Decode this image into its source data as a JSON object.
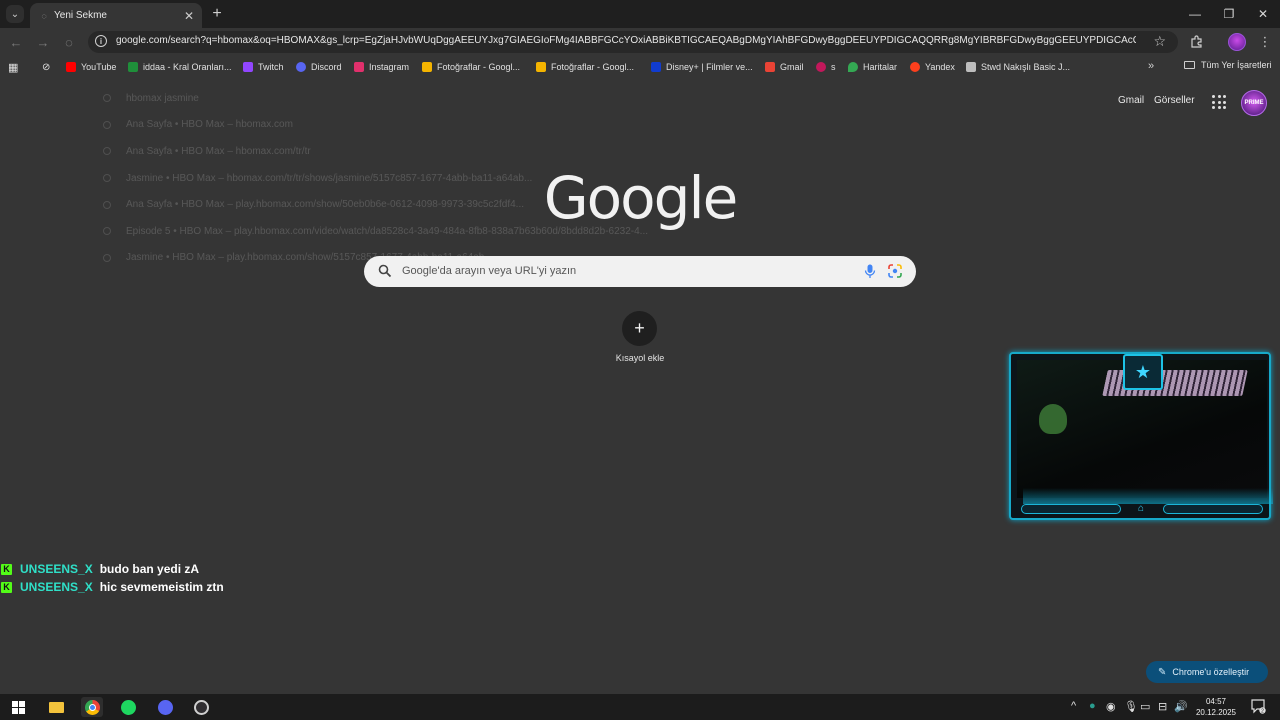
{
  "tab": {
    "title": "Yeni Sekme"
  },
  "toolbar": {
    "url": "google.com/search?q=hbomax&oq=HBOMAX&gs_lcrp=EgZjaHJvbWUqDggAEEUYJxg7GIAEGIoFMg4IABBFGCcYOxiABBiKBTIGCAEQABgDMgYIAhBFGDwyBggDEEUYPDIGCAQQRRg8MgYIBRBFGDwyBggGEEUYPDIGCAcQRRg..."
  },
  "bookmarks": {
    "items": [
      {
        "label": "YouTube",
        "icon": "youtube-icon",
        "color": "#ff0000"
      },
      {
        "label": "iddaa - Kral Oranları...",
        "icon": "iddaa-icon",
        "color": "#1f8f3a"
      },
      {
        "label": "Twitch",
        "icon": "twitch-icon",
        "color": "#9146ff"
      },
      {
        "label": "Discord",
        "icon": "discord-icon",
        "color": "#5865f2"
      },
      {
        "label": "Instagram",
        "icon": "instagram-icon",
        "color": "#e1306c"
      },
      {
        "label": "Fotoğraflar - Googl...",
        "icon": "google-photos-icon",
        "color": "#f4b400"
      },
      {
        "label": "Fotoğraflar - Googl...",
        "icon": "google-photos-icon",
        "color": "#f4b400"
      },
      {
        "label": "Disney+ | Filmler ve...",
        "icon": "disney-icon",
        "color": "#113ccf"
      },
      {
        "label": "Gmail",
        "icon": "gmail-icon",
        "color": "#ea4335"
      },
      {
        "label": "s",
        "icon": "site-icon",
        "color": "#c2185b"
      },
      {
        "label": "Haritalar",
        "icon": "maps-icon",
        "color": "#34a853"
      },
      {
        "label": "Yandex",
        "icon": "yandex-icon",
        "color": "#fc3f1d"
      },
      {
        "label": "Stwd Nakışlı Basic J...",
        "icon": "store-icon",
        "color": "#bdbdbd"
      }
    ],
    "more": "»",
    "all_bookmarks": "Tüm Yer İşaretleri"
  },
  "suggestions": [
    {
      "title": "hbomax jasmine",
      "url": ""
    },
    {
      "title": "Ana Sayfa • HBO Max",
      "url": "hbomax.com"
    },
    {
      "title": "Ana Sayfa • HBO Max",
      "url": "hbomax.com/tr/tr"
    },
    {
      "title": "Jasmine • HBO Max",
      "url": "hbomax.com/tr/tr/shows/jasmine/5157c857-1677-4abb-ba11-a64ab..."
    },
    {
      "title": "Ana Sayfa • HBO Max",
      "url": "play.hbomax.com/show/50eb0b6e-0612-4098-9973-39c5c2fdf4..."
    },
    {
      "title": "Episode 5 • HBO Max",
      "url": "play.hbomax.com/video/watch/da8528c4-3a49-484a-8fb8-838a7b63b60d/8bdd8d2b-6232-4..."
    },
    {
      "title": "Jasmine • HBO Max",
      "url": "play.hbomax.com/show/5157c857-1677-4abb-ba11-a64ab..."
    }
  ],
  "ntp": {
    "gmail": "Gmail",
    "images": "Görseller",
    "logo": "Google",
    "search_placeholder": "Google'da arayın veya URL'yi yazın",
    "add_shortcut": "Kısayol ekle",
    "customize": "Chrome'u özelleştir",
    "avatar_text": "PRIME"
  },
  "chat": [
    {
      "badge": "K",
      "user": "UNSEENS_X",
      "message": "budo ban yedi zA"
    },
    {
      "badge": "K",
      "user": "UNSEENS_X",
      "message": "hic sevmemeistim ztn"
    }
  ],
  "taskbar": {
    "time": "04:57",
    "date": "20.12.2025",
    "notification_count": "2"
  },
  "colors": {
    "page_bg": "#353535",
    "chat_user": "#2fe0c8",
    "kick_green": "#53fc18",
    "cam_accent": "#17a9c9",
    "customize_bg": "#0b4f7a"
  }
}
